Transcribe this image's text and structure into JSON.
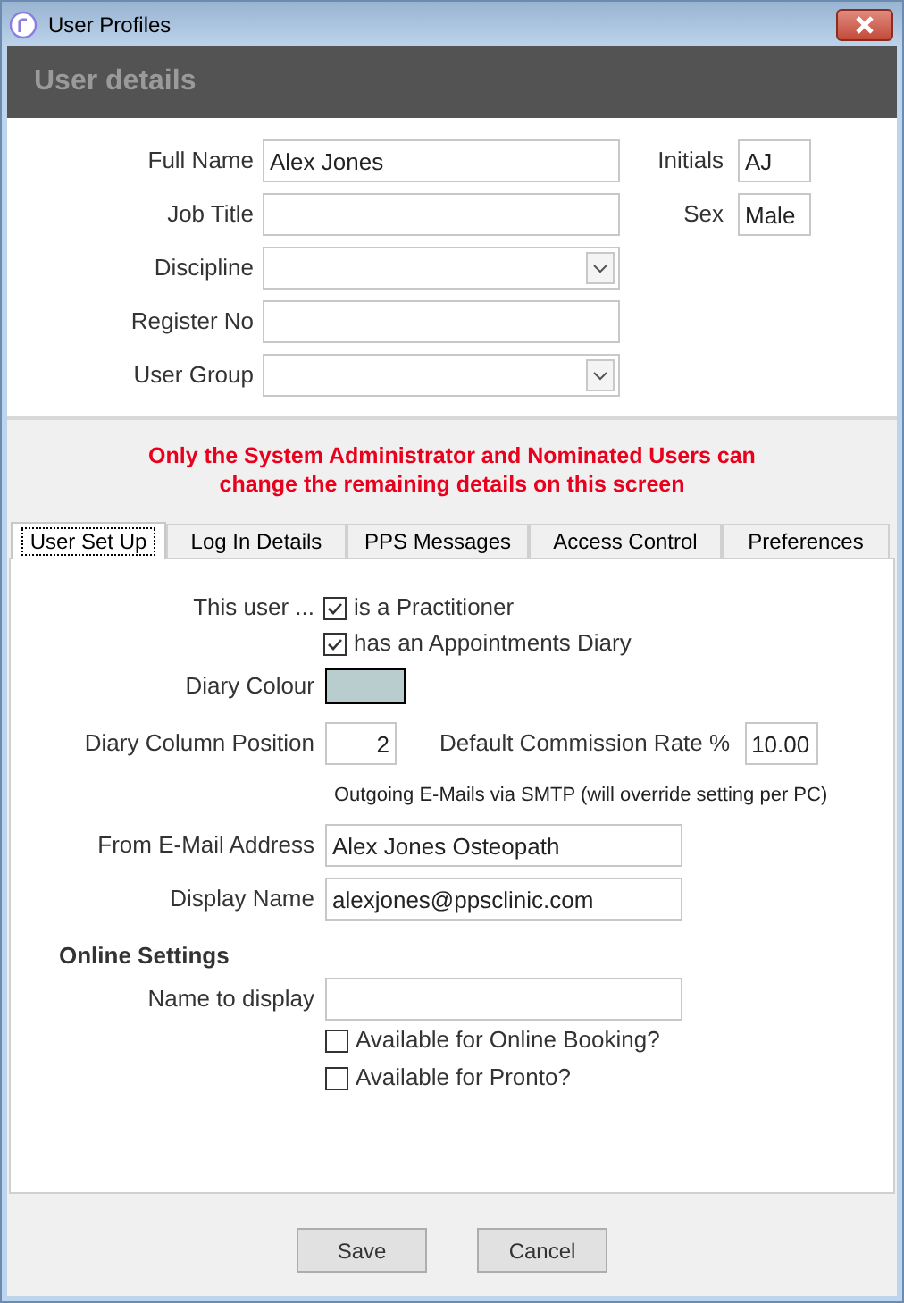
{
  "window": {
    "title": "User Profiles"
  },
  "header": {
    "title": "User details"
  },
  "user_details": {
    "left_fields": [
      {
        "label": "Full Name",
        "value": "Alex Jones",
        "kind": "text"
      },
      {
        "label": "Job Title",
        "kind": "text"
      },
      {
        "label": "Discipline",
        "kind": "dropdown"
      },
      {
        "label": "Register No",
        "kind": "text"
      },
      {
        "label": "User Group",
        "kind": "dropdown"
      }
    ],
    "right_fields": [
      {
        "label": "Initials",
        "value": "AJ"
      },
      {
        "label": "Sex",
        "value": "Male"
      }
    ]
  },
  "notice": "Only the System Administrator and Nominated Users can change the remaining details on this screen",
  "tabs": [
    {
      "label": "User Set Up",
      "selected": true
    },
    {
      "label": "Log In Details",
      "selected": false
    },
    {
      "label": "PPS Messages",
      "selected": false
    },
    {
      "label": "Access Control",
      "selected": false
    },
    {
      "label": "Preferences",
      "selected": false
    }
  ],
  "user_set_up": {
    "this_user_label": "This user ...",
    "options": [
      {
        "label": "is a Practitioner",
        "checked": true
      },
      {
        "label": "has an Appointments Diary",
        "checked": true
      }
    ],
    "diary_colour": {
      "label": "Diary Colour",
      "color": "#b9cdcf"
    },
    "diary_column_position": {
      "label": "Diary Column Position",
      "value": "2"
    },
    "commission_rate": {
      "label": "Default Commission Rate %",
      "value": "10.00"
    },
    "smtp_note": "Outgoing E-Mails via SMTP (will override setting per PC)",
    "email_fields": [
      {
        "label": "From E-Mail Address",
        "value": "Alex Jones Osteopath"
      },
      {
        "label": "Display Name",
        "value": "alexjones@ppsclinic.com"
      }
    ],
    "online_settings": {
      "title": "Online Settings",
      "name_field": {
        "label": "Name to display"
      },
      "options": [
        {
          "label": "Available for Online Booking?",
          "checked": false
        },
        {
          "label": "Available for Pronto?",
          "checked": false
        }
      ]
    }
  },
  "buttons": [
    {
      "label": "Save"
    },
    {
      "label": "Cancel"
    }
  ]
}
